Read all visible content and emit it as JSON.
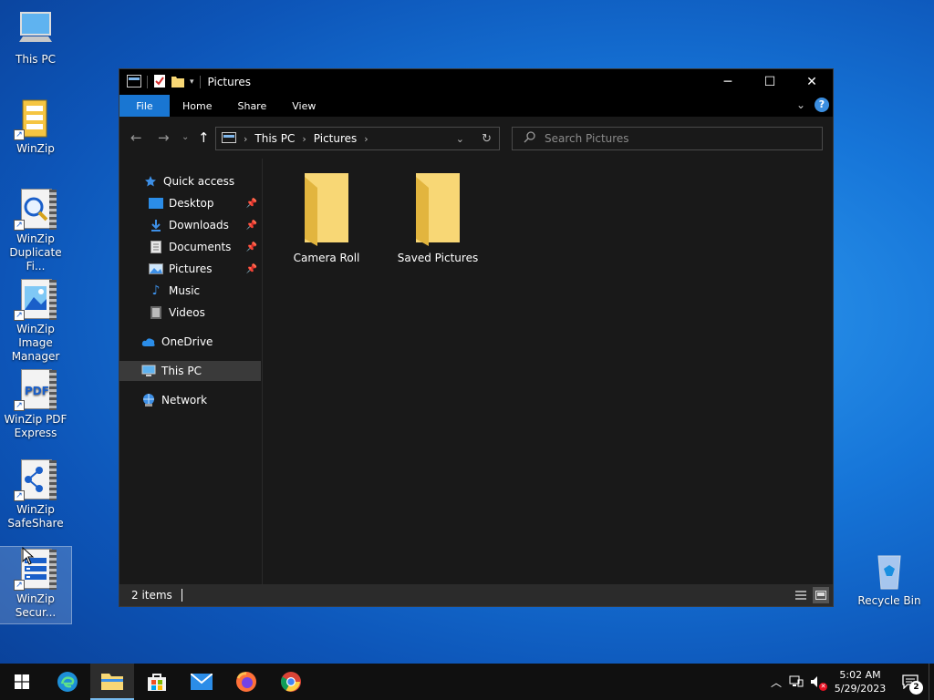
{
  "desktop": {
    "icons": [
      {
        "label": "This PC"
      },
      {
        "label": "WinZip"
      },
      {
        "label": "WinZip Duplicate Fi..."
      },
      {
        "label": "WinZip Image Manager"
      },
      {
        "label": "WinZip PDF Express"
      },
      {
        "label": "WinZip SafeShare"
      },
      {
        "label": "WinZip Secur..."
      }
    ],
    "recycle_bin": "Recycle Bin"
  },
  "window": {
    "title": "Pictures",
    "ribbon_tabs": [
      "File",
      "Home",
      "Share",
      "View"
    ],
    "breadcrumb": [
      "This PC",
      "Pictures"
    ],
    "search_placeholder": "Search Pictures",
    "nav": {
      "quick_access": "Quick access",
      "desktop": "Desktop",
      "downloads": "Downloads",
      "documents": "Documents",
      "pictures": "Pictures",
      "music": "Music",
      "videos": "Videos",
      "onedrive": "OneDrive",
      "this_pc": "This PC",
      "network": "Network"
    },
    "folders": [
      "Camera Roll",
      "Saved Pictures"
    ],
    "status": "2 items"
  },
  "taskbar": {
    "time": "5:02 AM",
    "date": "5/29/2023",
    "notification_count": "2"
  },
  "colors": {
    "accent": "#1976d2",
    "folder": "#f8d775"
  }
}
